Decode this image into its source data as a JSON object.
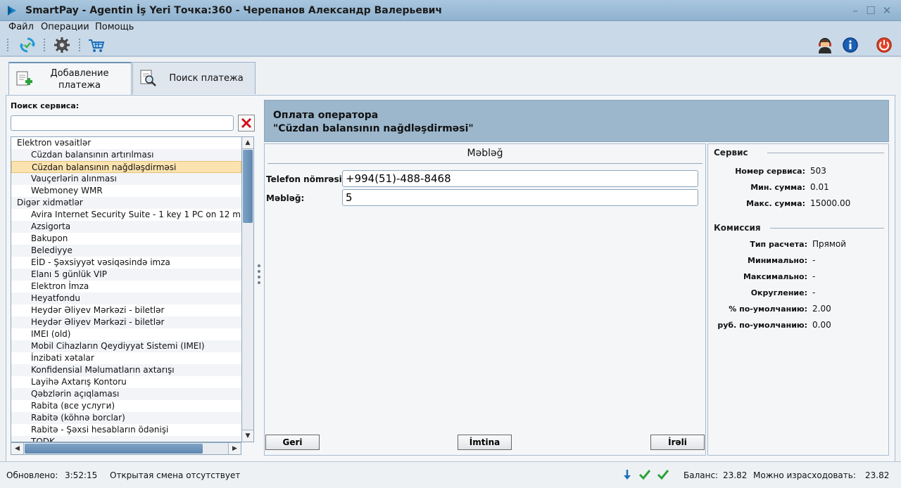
{
  "window": {
    "title": "SmartPay - Agentin İş Yeri Точка:360 - Черепанов Александр Валерьевич",
    "minimize": "–",
    "maximize": "☐",
    "close": "✕"
  },
  "menu": {
    "items": [
      "Файл",
      "Операции",
      "Помощь"
    ]
  },
  "toolbar": {
    "left": [
      "refresh-icon",
      "settings-gear-icon",
      "cart-icon"
    ],
    "right": [
      "support-operator-icon",
      "info-icon",
      "power-icon"
    ]
  },
  "tabs": [
    {
      "label_line1": "Добавление",
      "label_line2": "платежа",
      "icon": "add-document-icon",
      "active": true
    },
    {
      "label": "Поиск платежа",
      "icon": "search-document-icon",
      "active": false
    }
  ],
  "service_search": {
    "label": "Поиск сервиса:",
    "value": "",
    "placeholder": ""
  },
  "service_tree": [
    {
      "text": "Elektron vəsaitlər",
      "level": 0
    },
    {
      "text": "Cüzdan balansının artırılması",
      "level": 1
    },
    {
      "text": "Cüzdan balansının nağdləşdirməsi",
      "level": 1,
      "selected": true
    },
    {
      "text": "Vauçerlərin alınması",
      "level": 1
    },
    {
      "text": "Webmoney WMR",
      "level": 1
    },
    {
      "text": "Digər xidmətlər",
      "level": 0
    },
    {
      "text": "Avira Internet Security Suite - 1 key 1 PC on 12 m",
      "level": 1
    },
    {
      "text": "Azsigorta",
      "level": 1
    },
    {
      "text": "Bakupon",
      "level": 1
    },
    {
      "text": "Belediyye",
      "level": 1
    },
    {
      "text": "EİD - Şəxsiyyət vəsiqəsində imza",
      "level": 1
    },
    {
      "text": "Elanı 5 günlük VIP",
      "level": 1
    },
    {
      "text": "Elektron İmza",
      "level": 1
    },
    {
      "text": "Heyatfondu",
      "level": 1
    },
    {
      "text": "Heydər Əliyev Mərkəzi - biletlər",
      "level": 1
    },
    {
      "text": "Heydər Əliyev Mərkəzi - biletlər",
      "level": 1
    },
    {
      "text": "IMEI (old)",
      "level": 1
    },
    {
      "text": "Mobil Cihazların Qeydiyyat Sistemi (IMEI)",
      "level": 1
    },
    {
      "text": "İnzibati xətalar",
      "level": 1
    },
    {
      "text": "Konfidensial Məlumatların axtarışı",
      "level": 1
    },
    {
      "text": "Layihə Axtarış Kontoru",
      "level": 1
    },
    {
      "text": "Qəbzlərin açıqlaması",
      "level": 1
    },
    {
      "text": "Rabita (все услуги)",
      "level": 1
    },
    {
      "text": "Rabitə (köhnə borclar)",
      "level": 1
    },
    {
      "text": "Rabitə - Şəxsi hesabların ödənişi",
      "level": 1
    },
    {
      "text": "TODK",
      "level": 1
    }
  ],
  "operator": {
    "line1": "Оплата оператора",
    "line2": "\"Cüzdan balansının nağdləşdirməsi\""
  },
  "form": {
    "title": "Məbləğ",
    "phone_label": "Telefon nömrəsi:",
    "phone_value": "+994(51)-488-8468",
    "amount_label": "Məbləğ:",
    "amount_value": "5",
    "back_button": "Geri",
    "cancel_button": "İmtina",
    "next_button": "İrəli"
  },
  "service_info": {
    "title": "Сервис",
    "rows": [
      {
        "key": "Номер сервиса:",
        "value": "503"
      },
      {
        "key": "Мин. сумма:",
        "value": "0.01"
      },
      {
        "key": "Макс. сумма:",
        "value": "15000.00"
      }
    ]
  },
  "commission": {
    "title": "Комиссия",
    "rows": [
      {
        "key": "Тип расчета:",
        "value": "Прямой"
      },
      {
        "key": "Минимально:",
        "value": "-"
      },
      {
        "key": "Максимально:",
        "value": "-"
      },
      {
        "key": "Округление:",
        "value": "-"
      },
      {
        "key": "% по-умолчанию:",
        "value": "2.00"
      },
      {
        "key": "руб. по-умолчанию:",
        "value": "0.00"
      }
    ]
  },
  "status": {
    "updated_label": "Обновлено:",
    "updated_time": "3:52:15",
    "shift": "Открытая смена отсутствует",
    "icons": [
      "download-arrow-icon",
      "check-icon",
      "check-icon"
    ],
    "balance_label": "Баланс:",
    "balance": "23.82",
    "spendable_label": "Можно израсходовать:",
    "spendable": "23.82"
  },
  "colors": {
    "title_bar": "#8fb2cf",
    "selected_row": "#fbe3b0",
    "header_panel": "#9cb7cc",
    "scroll_thumb": "#6f96bd"
  }
}
